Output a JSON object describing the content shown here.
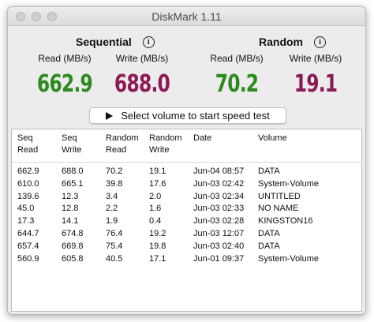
{
  "window": {
    "title": "DiskMark 1.11"
  },
  "sequential": {
    "heading": "Sequential",
    "read_label": "Read (MB/s)",
    "read_value": "662.9",
    "write_label": "Write (MB/s)",
    "write_value": "688.0"
  },
  "random": {
    "heading": "Random",
    "read_label": "Read (MB/s)",
    "read_value": "70.2",
    "write_label": "Write (MB/s)",
    "write_value": "19.1"
  },
  "start_button": {
    "label": "Select volume to start speed test"
  },
  "table": {
    "headers": [
      [
        "Seq",
        "Read"
      ],
      [
        "Seq",
        "Write"
      ],
      [
        "Random",
        "Read"
      ],
      [
        "Random",
        "Write"
      ],
      [
        "Date",
        ""
      ],
      [
        "Volume",
        ""
      ]
    ],
    "rows": [
      [
        "662.9",
        "688.0",
        "70.2",
        "19.1",
        "Jun-04 08:57",
        "DATA"
      ],
      [
        "610.0",
        "665.1",
        "39.8",
        "17.6",
        "Jun-03 02:42",
        "System-Volume"
      ],
      [
        "139.6",
        "12.3",
        "3.4",
        "2.0",
        "Jun-03 02:34",
        "UNTITLED"
      ],
      [
        "45.0",
        "12.8",
        "2.2",
        "1.6",
        "Jun-03 02:33",
        "NO NAME"
      ],
      [
        "17.3",
        "14.1",
        "1.9",
        "0.4",
        "Jun-03 02:28",
        "KINGSTON16"
      ],
      [
        "644.7",
        "674.8",
        "76.4",
        "19.2",
        "Jun-03 12:07",
        "DATA"
      ],
      [
        "657.4",
        "669.8",
        "75.4",
        "19.8",
        "Jun-03 02:40",
        "DATA"
      ],
      [
        "560.9",
        "605.8",
        "40.5",
        "17.1",
        "Jun-01 09:37",
        "System-Volume"
      ]
    ]
  },
  "colors": {
    "read_value": "#2c8a1e",
    "write_value": "#8c1a55"
  },
  "icons": {
    "info": "info-icon",
    "play": "play-icon"
  }
}
